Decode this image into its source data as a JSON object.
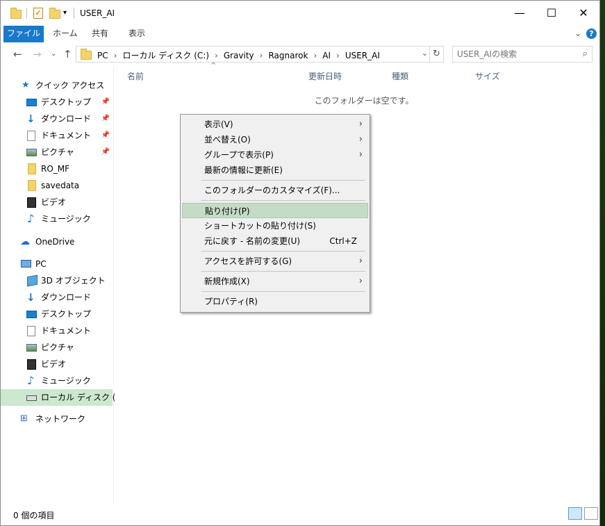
{
  "window": {
    "title": "USER_AI",
    "controls": {
      "minimize": "—",
      "maximize": "☐",
      "close": "✕"
    }
  },
  "ribbon": {
    "tabs": [
      "ファイル",
      "ホーム",
      "共有",
      "表示"
    ],
    "help": "?",
    "collapse": "⌄"
  },
  "navigation": {
    "back": "←",
    "forward": "→",
    "recent": "⌄",
    "up": "↑",
    "breadcrumb": [
      "PC",
      "ローカル ディスク (C:)",
      "Gravity",
      "Ragnarok",
      "AI",
      "USER_AI"
    ],
    "crumb_separator": "›",
    "address_dropdown": "⌄",
    "refresh": "↻",
    "search_placeholder": "USER_AIの検索",
    "search_icon": "⌕"
  },
  "sidebar": {
    "items": [
      {
        "label": "クイック アクセス",
        "icon": "star-icon",
        "pinned": false
      },
      {
        "label": "デスクトップ",
        "icon": "desktop-icon",
        "pinned": true
      },
      {
        "label": "ダウンロード",
        "icon": "download-icon",
        "pinned": true
      },
      {
        "label": "ドキュメント",
        "icon": "document-icon",
        "pinned": true
      },
      {
        "label": "ピクチャ",
        "icon": "pictures-icon",
        "pinned": true
      },
      {
        "label": "RO_MF",
        "icon": "folder-icon",
        "pinned": false
      },
      {
        "label": "savedata",
        "icon": "folder-icon",
        "pinned": false
      },
      {
        "label": "ビデオ",
        "icon": "video-icon",
        "pinned": false
      },
      {
        "label": "ミュージック",
        "icon": "music-icon",
        "pinned": false
      },
      {
        "label": "OneDrive",
        "icon": "cloud-icon",
        "pinned": false
      },
      {
        "label": "PC",
        "icon": "pc-icon",
        "pinned": false
      },
      {
        "label": "3D オブジェクト",
        "icon": "3d-objects-icon",
        "pinned": false
      },
      {
        "label": "ダウンロード",
        "icon": "download-icon",
        "pinned": false
      },
      {
        "label": "デスクトップ",
        "icon": "desktop-icon",
        "pinned": false
      },
      {
        "label": "ドキュメント",
        "icon": "document-icon",
        "pinned": false
      },
      {
        "label": "ピクチャ",
        "icon": "pictures-icon",
        "pinned": false
      },
      {
        "label": "ビデオ",
        "icon": "video-icon",
        "pinned": false
      },
      {
        "label": "ミュージック",
        "icon": "music-icon",
        "pinned": false
      },
      {
        "label": "ローカル ディスク (C:)",
        "icon": "drive-icon",
        "pinned": false,
        "selected": true
      },
      {
        "label": "ネットワーク",
        "icon": "network-icon",
        "pinned": false
      }
    ],
    "pin_glyph": "📌"
  },
  "content": {
    "columns": [
      "名前",
      "更新日時",
      "種類",
      "サイズ"
    ],
    "sort_caret": "^",
    "empty_message": "このフォルダーは空です。"
  },
  "context_menu": {
    "items": [
      {
        "label": "表示(V)",
        "submenu": true
      },
      {
        "label": "並べ替え(O)",
        "submenu": true
      },
      {
        "label": "グループで表示(P)",
        "submenu": true
      },
      {
        "label": "最新の情報に更新(E)",
        "submenu": false
      },
      {
        "label": "このフォルダーのカスタマイズ(F)...",
        "submenu": false
      },
      {
        "label": "貼り付け(P)",
        "submenu": false,
        "highlighted": true
      },
      {
        "label": "ショートカットの貼り付け(S)",
        "submenu": false
      },
      {
        "label": "元に戻す - 名前の変更(U)",
        "submenu": false,
        "shortcut": "Ctrl+Z"
      },
      {
        "label": "アクセスを許可する(G)",
        "submenu": true
      },
      {
        "label": "新規作成(X)",
        "submenu": true
      },
      {
        "label": "プロパティ(R)",
        "submenu": false
      }
    ],
    "arrow_glyph": "›"
  },
  "status": {
    "item_count": "0 個の項目"
  },
  "colors": {
    "accent": "#1979ca",
    "selection": "#cce8cf",
    "menu_highlight": "#c4dcc6",
    "folder": "#f3d36b"
  }
}
